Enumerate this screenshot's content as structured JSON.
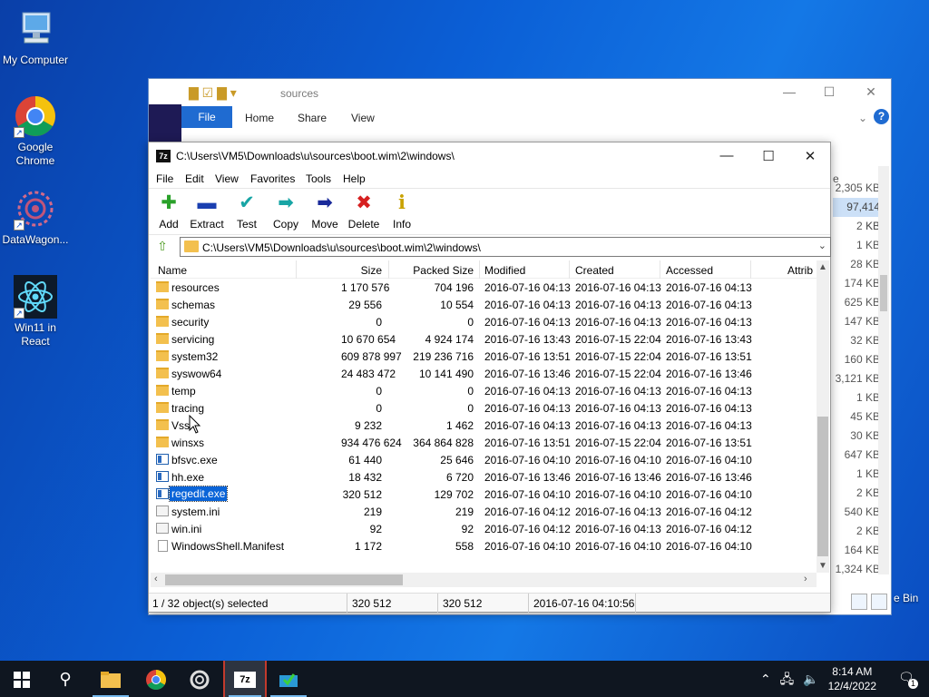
{
  "desktop": {
    "icons": [
      {
        "label": "My Computer"
      },
      {
        "label": "Google Chrome"
      },
      {
        "label": "DataWagon..."
      },
      {
        "label": "Win11 in React"
      }
    ],
    "recycle_bin_partial": "e Bin"
  },
  "explorer": {
    "title": "sources",
    "ribbon": {
      "file": "File",
      "home": "Home",
      "share": "Share",
      "view": "View"
    },
    "column_partial": "e",
    "sizes": [
      "2,305 KB",
      "97,414 KB",
      "2 KB",
      "1 KB",
      "28 KB",
      "174 KB",
      "625 KB",
      "147 KB",
      "32 KB",
      "160 KB",
      "3,121 KB",
      "1 KB",
      "45 KB",
      "30 KB",
      "647 KB",
      "1 KB",
      "2 KB",
      "540 KB",
      "2 KB",
      "164 KB",
      "1,324 KB"
    ]
  },
  "zip": {
    "title": "C:\\Users\\VM5\\Downloads\\u\\sources\\boot.wim\\2\\windows\\",
    "menu": {
      "file": "File",
      "edit": "Edit",
      "view": "View",
      "favorites": "Favorites",
      "tools": "Tools",
      "help": "Help"
    },
    "toolbar": {
      "add": "Add",
      "extract": "Extract",
      "test": "Test",
      "copy": "Copy",
      "move": "Move",
      "delete": "Delete",
      "info": "Info"
    },
    "address": "C:\\Users\\VM5\\Downloads\\u\\sources\\boot.wim\\2\\windows\\",
    "columns": {
      "name": "Name",
      "size": "Size",
      "packed": "Packed Size",
      "modified": "Modified",
      "created": "Created",
      "accessed": "Accessed",
      "attrib": "Attrib"
    },
    "rows": [
      {
        "name": "resources",
        "size": "1 170 576",
        "packed": "704 196",
        "modified": "2016-07-16 04:13",
        "created": "2016-07-16 04:13",
        "accessed": "2016-07-16 04:13",
        "type": "folder"
      },
      {
        "name": "schemas",
        "size": "29 556",
        "packed": "10 554",
        "modified": "2016-07-16 04:13",
        "created": "2016-07-16 04:13",
        "accessed": "2016-07-16 04:13",
        "type": "folder"
      },
      {
        "name": "security",
        "size": "0",
        "packed": "0",
        "modified": "2016-07-16 04:13",
        "created": "2016-07-16 04:13",
        "accessed": "2016-07-16 04:13",
        "type": "folder"
      },
      {
        "name": "servicing",
        "size": "10 670 654",
        "packed": "4 924 174",
        "modified": "2016-07-16 13:43",
        "created": "2016-07-15 22:04",
        "accessed": "2016-07-16 13:43",
        "type": "folder"
      },
      {
        "name": "system32",
        "size": "609 878 997",
        "packed": "219 236 716",
        "modified": "2016-07-16 13:51",
        "created": "2016-07-15 22:04",
        "accessed": "2016-07-16 13:51",
        "type": "folder"
      },
      {
        "name": "syswow64",
        "size": "24 483 472",
        "packed": "10 141 490",
        "modified": "2016-07-16 13:46",
        "created": "2016-07-15 22:04",
        "accessed": "2016-07-16 13:46",
        "type": "folder"
      },
      {
        "name": "temp",
        "size": "0",
        "packed": "0",
        "modified": "2016-07-16 04:13",
        "created": "2016-07-16 04:13",
        "accessed": "2016-07-16 04:13",
        "type": "folder"
      },
      {
        "name": "tracing",
        "size": "0",
        "packed": "0",
        "modified": "2016-07-16 04:13",
        "created": "2016-07-16 04:13",
        "accessed": "2016-07-16 04:13",
        "type": "folder"
      },
      {
        "name": "Vss",
        "size": "9 232",
        "packed": "1 462",
        "modified": "2016-07-16 04:13",
        "created": "2016-07-16 04:13",
        "accessed": "2016-07-16 04:13",
        "type": "folder"
      },
      {
        "name": "winsxs",
        "size": "934 476 624",
        "packed": "364 864 828",
        "modified": "2016-07-16 13:51",
        "created": "2016-07-15 22:04",
        "accessed": "2016-07-16 13:51",
        "type": "folder"
      },
      {
        "name": "bfsvc.exe",
        "size": "61 440",
        "packed": "25 646",
        "modified": "2016-07-16 04:10",
        "created": "2016-07-16 04:10",
        "accessed": "2016-07-16 04:10",
        "type": "exe"
      },
      {
        "name": "hh.exe",
        "size": "18 432",
        "packed": "6 720",
        "modified": "2016-07-16 13:46",
        "created": "2016-07-16 13:46",
        "accessed": "2016-07-16 13:46",
        "type": "exe"
      },
      {
        "name": "regedit.exe",
        "size": "320 512",
        "packed": "129 702",
        "modified": "2016-07-16 04:10",
        "created": "2016-07-16 04:10",
        "accessed": "2016-07-16 04:10",
        "type": "exe",
        "selected": true
      },
      {
        "name": "system.ini",
        "size": "219",
        "packed": "219",
        "modified": "2016-07-16 04:12",
        "created": "2016-07-16 04:13",
        "accessed": "2016-07-16 04:12",
        "type": "ini"
      },
      {
        "name": "win.ini",
        "size": "92",
        "packed": "92",
        "modified": "2016-07-16 04:12",
        "created": "2016-07-16 04:13",
        "accessed": "2016-07-16 04:12",
        "type": "ini"
      },
      {
        "name": "WindowsShell.Manifest",
        "size": "1 172",
        "packed": "558",
        "modified": "2016-07-16 04:10",
        "created": "2016-07-16 04:10",
        "accessed": "2016-07-16 04:10",
        "type": "file"
      }
    ],
    "status": {
      "selected": "1 / 32 object(s) selected",
      "size": "320 512",
      "packed": "320 512",
      "date": "2016-07-16 04:10:56"
    }
  },
  "taskbar": {
    "time": "8:14 AM",
    "date": "12/4/2022",
    "notifications": "1"
  },
  "colors": {
    "selection": "#0a64d8",
    "taskbar": "#0f1620",
    "folder": "#f3c04e"
  }
}
